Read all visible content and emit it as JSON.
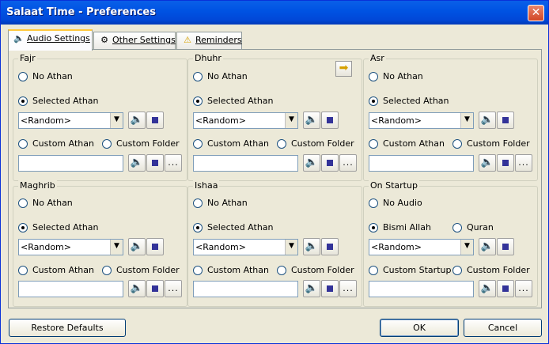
{
  "window": {
    "title": "Salaat Time - Preferences",
    "close_glyph": "✕"
  },
  "tabs": [
    {
      "label": "Audio Settings",
      "icon": "speaker-icon",
      "glyph": "🔈"
    },
    {
      "label": "Other Settings",
      "icon": "settings-icon",
      "glyph": "⚙"
    },
    {
      "label": "Reminders",
      "icon": "warning-icon",
      "glyph": "⚠"
    }
  ],
  "prayer_groups": [
    {
      "name": "Fajr",
      "no_athan": "No Athan",
      "selected_athan": "Selected Athan",
      "select_value": "<Random>",
      "custom_athan": "Custom Athan",
      "custom_folder": "Custom Folder",
      "custom_value": ""
    },
    {
      "name": "Dhuhr",
      "no_athan": "No Athan",
      "selected_athan": "Selected Athan",
      "select_value": "<Random>",
      "custom_athan": "Custom Athan",
      "custom_folder": "Custom Folder",
      "custom_value": ""
    },
    {
      "name": "Asr",
      "no_athan": "No Athan",
      "selected_athan": "Selected Athan",
      "select_value": "<Random>",
      "custom_athan": "Custom Athan",
      "custom_folder": "Custom Folder",
      "custom_value": ""
    },
    {
      "name": "Maghrib",
      "no_athan": "No Athan",
      "selected_athan": "Selected Athan",
      "select_value": "<Random>",
      "custom_athan": "Custom Athan",
      "custom_folder": "Custom Folder",
      "custom_value": ""
    },
    {
      "name": "Ishaa",
      "no_athan": "No Athan",
      "selected_athan": "Selected Athan",
      "select_value": "<Random>",
      "custom_athan": "Custom Athan",
      "custom_folder": "Custom Folder",
      "custom_value": ""
    }
  ],
  "startup_group": {
    "name": "On Startup",
    "no_audio": "No Audio",
    "bismi_allah": "Bismi Allah",
    "quran": "Quran",
    "select_value": "<Random>",
    "custom_startup": "Custom Startup",
    "custom_folder": "Custom Folder",
    "custom_value": ""
  },
  "glyphs": {
    "dropdown": "▼",
    "speaker": "🔈",
    "browse": "...",
    "next": "➡"
  },
  "buttons": {
    "restore_defaults": "Restore Defaults",
    "ok": "OK",
    "cancel": "Cancel"
  },
  "colors": {
    "title_bar": "#0054e3",
    "close_button": "#d24726",
    "active_tab_accent": "#ffc83c",
    "radio_dot": "#21a121",
    "stop_square": "#333399"
  }
}
